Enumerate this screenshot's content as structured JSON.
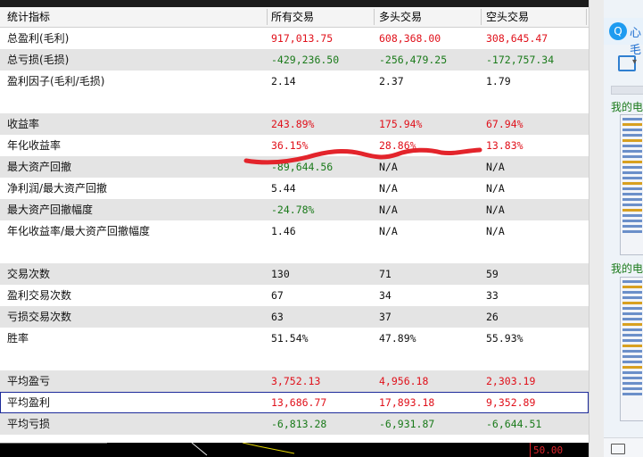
{
  "header": {
    "c0": "统计指标",
    "c1": "所有交易",
    "c2": "多头交易",
    "c3": "空头交易"
  },
  "rows": [
    {
      "type": "data",
      "label": "总盈利(毛利)",
      "v": [
        "917,013.75",
        "608,368.00",
        "308,645.47"
      ],
      "cls": [
        "pos",
        "pos",
        "pos"
      ],
      "odd": false
    },
    {
      "type": "data",
      "label": "总亏损(毛损)",
      "v": [
        "-429,236.50",
        "-256,479.25",
        "-172,757.34"
      ],
      "cls": [
        "neg",
        "neg",
        "neg"
      ],
      "odd": true
    },
    {
      "type": "data",
      "label": "盈利因子(毛利/毛损)",
      "v": [
        "2.14",
        "2.37",
        "1.79"
      ],
      "cls": [
        "",
        "",
        ""
      ],
      "odd": false
    },
    {
      "type": "spacer"
    },
    {
      "type": "data",
      "label": "收益率",
      "v": [
        "243.89%",
        "175.94%",
        "67.94%"
      ],
      "cls": [
        "pos",
        "pos",
        "pos"
      ],
      "odd": true
    },
    {
      "type": "data",
      "label": "年化收益率",
      "v": [
        "36.15%",
        "28.86%",
        "13.83%"
      ],
      "cls": [
        "pos",
        "pos",
        "pos"
      ],
      "odd": false
    },
    {
      "type": "data",
      "label": "最大资产回撤",
      "v": [
        "-89,644.56",
        "N/A",
        "N/A"
      ],
      "cls": [
        "neg",
        "",
        ""
      ],
      "odd": true
    },
    {
      "type": "data",
      "label": "净利润/最大资产回撤",
      "v": [
        "5.44",
        "N/A",
        "N/A"
      ],
      "cls": [
        "",
        "",
        ""
      ],
      "odd": false
    },
    {
      "type": "data",
      "label": "最大资产回撤幅度",
      "v": [
        "-24.78%",
        "N/A",
        "N/A"
      ],
      "cls": [
        "neg",
        "",
        ""
      ],
      "odd": true
    },
    {
      "type": "data",
      "label": "年化收益率/最大资产回撤幅度",
      "v": [
        "1.46",
        "N/A",
        "N/A"
      ],
      "cls": [
        "",
        "",
        ""
      ],
      "odd": false
    },
    {
      "type": "spacer"
    },
    {
      "type": "data",
      "label": "交易次数",
      "v": [
        "130",
        "71",
        "59"
      ],
      "cls": [
        "",
        "",
        ""
      ],
      "odd": true
    },
    {
      "type": "data",
      "label": "盈利交易次数",
      "v": [
        "67",
        "34",
        "33"
      ],
      "cls": [
        "",
        "",
        ""
      ],
      "odd": false
    },
    {
      "type": "data",
      "label": "亏损交易次数",
      "v": [
        "63",
        "37",
        "26"
      ],
      "cls": [
        "",
        "",
        ""
      ],
      "odd": true
    },
    {
      "type": "data",
      "label": "胜率",
      "v": [
        "51.54%",
        "47.89%",
        "55.93%"
      ],
      "cls": [
        "",
        "",
        ""
      ],
      "odd": false
    },
    {
      "type": "spacer"
    },
    {
      "type": "data",
      "label": "平均盈亏",
      "v": [
        "3,752.13",
        "4,956.18",
        "2,303.19"
      ],
      "cls": [
        "pos",
        "pos",
        "pos"
      ],
      "odd": true
    },
    {
      "type": "data",
      "label": "平均盈利",
      "v": [
        "13,686.77",
        "17,893.18",
        "9,352.89"
      ],
      "cls": [
        "pos",
        "pos",
        "pos"
      ],
      "odd": false,
      "selected": true
    },
    {
      "type": "data",
      "label": "平均亏损",
      "v": [
        "-6,813.28",
        "-6,931.87",
        "-6,644.51"
      ],
      "cls": [
        "neg",
        "neg",
        "neg"
      ],
      "odd": true
    }
  ],
  "bottom": {
    "value": "50.00"
  },
  "side": {
    "title": "心毛",
    "logo": "Q",
    "label1": "我的电",
    "label2": "我的电"
  },
  "colors": {
    "positive": "#e0101a",
    "negative": "#1a7a1a",
    "annotation": "#e3242b"
  }
}
